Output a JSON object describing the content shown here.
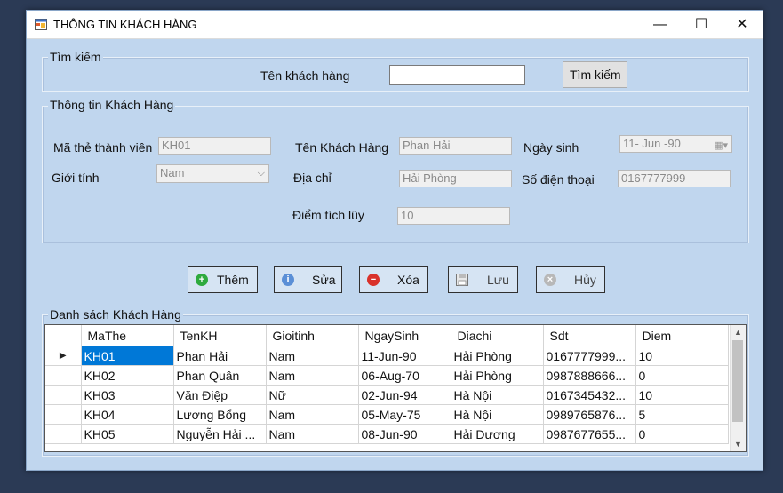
{
  "window": {
    "title": "THÔNG TIN KHÁCH HÀNG",
    "minimize_glyph": "—",
    "maximize_glyph": "☐",
    "close_glyph": "✕"
  },
  "search": {
    "group_label": "Tìm kiếm",
    "name_label": "Tên khách hàng",
    "input_value": "",
    "button_label": "Tìm kiếm"
  },
  "info": {
    "group_label": "Thông tin Khách Hàng",
    "member_id_label": "Mã thẻ thành viên",
    "member_id_value": "KH01",
    "gender_label": "Giới tính",
    "gender_value": "Nam",
    "name_label": "Tên Khách Hàng",
    "name_value": "Phan Hải",
    "address_label": "Địa chỉ",
    "address_value": "Hải Phòng",
    "points_label": "Điểm tích lũy",
    "points_value": "10",
    "dob_label": "Ngày sinh",
    "dob_value": "11- Jun -90",
    "phone_label": "Số điện thoại",
    "phone_value": "0167777999"
  },
  "actions": {
    "add_label": "Thêm",
    "edit_label": "Sửa",
    "delete_label": "Xóa",
    "save_label": "Lưu",
    "cancel_label": "Hủy"
  },
  "list": {
    "group_label": "Danh sách Khách Hàng",
    "columns": [
      "MaThe",
      "TenKH",
      "Gioitinh",
      "NgaySinh",
      "Diachi",
      "Sdt",
      "Diem"
    ],
    "rows": [
      [
        "KH01",
        "Phan Hải",
        "Nam",
        "11-Jun-90",
        "Hải Phòng",
        "0167777999...",
        "10"
      ],
      [
        "KH02",
        "Phan Quân",
        "Nam",
        "06-Aug-70",
        "Hải Phòng",
        "0987888666...",
        "0"
      ],
      [
        "KH03",
        "Văn Điệp",
        "Nữ",
        "02-Jun-94",
        "Hà Nội",
        "0167345432...",
        "10"
      ],
      [
        "KH04",
        "Lương Bổng",
        "Nam",
        "05-May-75",
        "Hà Nội",
        "0989765876...",
        "5"
      ],
      [
        "KH05",
        "Nguyễn Hải ...",
        "Nam",
        "08-Jun-90",
        "Hải Dương",
        "0987677655...",
        "0"
      ]
    ],
    "current_row_marker": "▶"
  },
  "colors": {
    "form_bg": "#c0d6ee",
    "selection": "#0078d7",
    "add_icon": "#2eaa3e",
    "delete_icon": "#d9322b",
    "edit_icon": "#5b8fd6"
  }
}
